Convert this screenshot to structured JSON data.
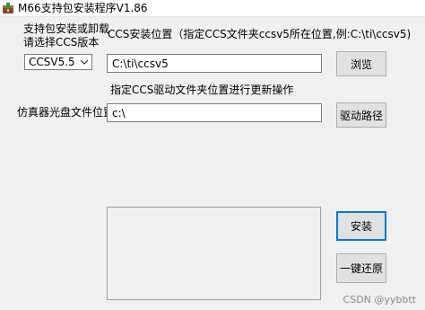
{
  "window": {
    "title": "M66支持包安装程序V1.86",
    "icon": "installer-package-icon"
  },
  "version_section": {
    "label_line1": "支持包安装或卸载",
    "label_line2": "请选择CCS版本",
    "selected_version": "CCSV5.5"
  },
  "ccs_section": {
    "label": "CCS安装位置（指定CCS文件夹ccsv5所在位置,例:C:\\ti\\ccsv5)",
    "path_value": "C:\\ti\\ccsv5",
    "browse_label": "浏览"
  },
  "driver_section": {
    "label": "指定CCS驱动文件夹位置进行更新操作",
    "row_label": "仿真器光盘文件位置",
    "path_value": "c:\\",
    "driver_path_button_label": "驱动路径"
  },
  "actions": {
    "install_label": "安装",
    "restore_label": "一键还原"
  },
  "watermark": "CSDN @yybbtt",
  "colors": {
    "background": "#f0f0f0",
    "button_face": "#e1e1e1",
    "focus_border": "#0078d7"
  }
}
